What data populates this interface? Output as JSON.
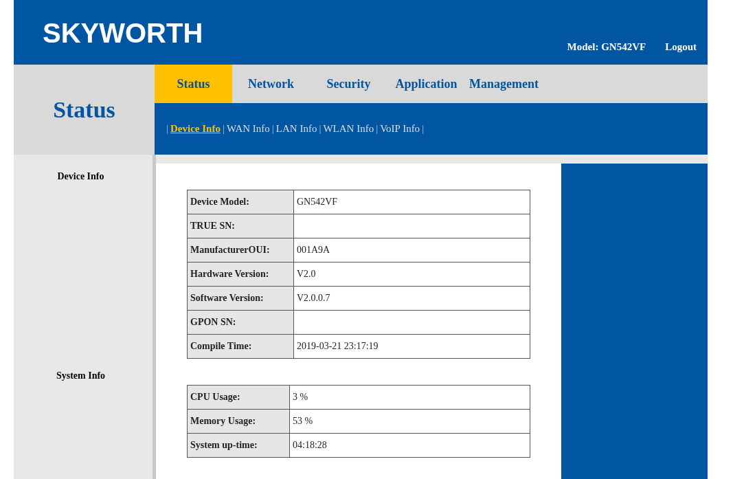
{
  "header": {
    "logo": "SKYWORTH",
    "model": "Model: GN542VF",
    "logout": "Logout"
  },
  "page_title": "Status",
  "tabs": [
    {
      "label": "Status",
      "selected": true
    },
    {
      "label": "Network",
      "selected": false
    },
    {
      "label": "Security",
      "selected": false
    },
    {
      "label": "Application",
      "selected": false
    },
    {
      "label": "Management",
      "selected": false
    }
  ],
  "subnav": {
    "separator": "|",
    "items": [
      {
        "label": "Device Info",
        "selected": true
      },
      {
        "label": "WAN Info",
        "selected": false
      },
      {
        "label": "LAN Info",
        "selected": false
      },
      {
        "label": "WLAN Info",
        "selected": false
      },
      {
        "label": "VoIP Info",
        "selected": false
      }
    ]
  },
  "sections": [
    {
      "title": "Device Info",
      "rows": [
        {
          "label": "Device Model:",
          "value": "GN542VF"
        },
        {
          "label": "TRUE SN:",
          "value": ""
        },
        {
          "label": "ManufacturerOUI:",
          "value": "001A9A"
        },
        {
          "label": "Hardware Version:",
          "value": "V2.0"
        },
        {
          "label": "Software Version:",
          "value": "V2.0.0.7"
        },
        {
          "label": "GPON SN:",
          "value": ""
        },
        {
          "label": "Compile Time:",
          "value": "2019-03-21 23:17:19"
        }
      ]
    },
    {
      "title": "System Info",
      "rows": [
        {
          "label": "CPU Usage:",
          "value": "3 %"
        },
        {
          "label": "Memory Usage:",
          "value": "53 %"
        },
        {
          "label": "System up-time:",
          "value": "04:18:28"
        }
      ]
    }
  ]
}
